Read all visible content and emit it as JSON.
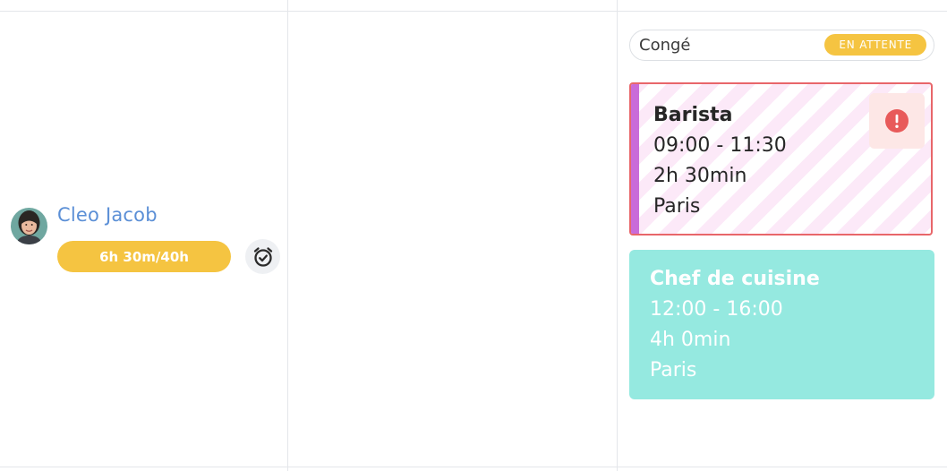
{
  "employee": {
    "name": "Cleo Jacob",
    "hours": "6h 30m/40h"
  },
  "leave": {
    "label": "Congé",
    "status": "EN ATTENTE"
  },
  "shifts": [
    {
      "role": "Barista",
      "time": "09:00 - 11:30",
      "duration": "2h 30min",
      "location": "Paris"
    },
    {
      "role": "Chef de cuisine",
      "time": "12:00 - 16:00",
      "duration": "4h 0min",
      "location": "Paris"
    }
  ],
  "colors": {
    "accent_yellow": "#f5c441",
    "name_blue": "#5b8fd6",
    "shift_alert_border": "#e8666a",
    "shift_stripe": "#fce9f8",
    "shift_accent_bar": "#c96bd9",
    "shift_teal": "#95e9e0",
    "alert_red": "#e85a5a"
  },
  "icons": {
    "alarm": "alarm-clock-check-icon",
    "alert": "exclamation-circle-icon",
    "avatar": "user-avatar"
  }
}
